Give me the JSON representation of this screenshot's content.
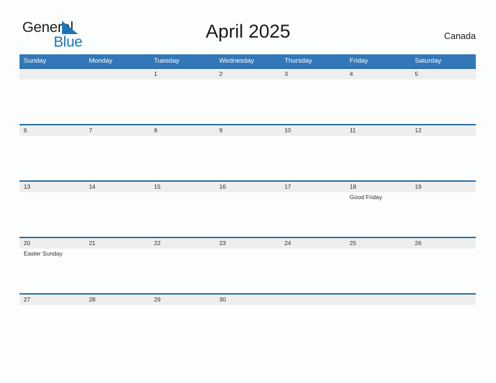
{
  "brand": {
    "name_top": "General",
    "name_bottom": "Blue",
    "accent_color": "#1b75bb",
    "triangle_icon": "triangle-right-icon"
  },
  "header": {
    "title": "April 2025",
    "country": "Canada"
  },
  "theme": {
    "header_blue": "#3277b8",
    "row_rule_blue": "#2b6ca3",
    "row_band_gray": "#eeeeee",
    "page_background": "#fcfdfd",
    "text_color": "#2d2d2d"
  },
  "calendar": {
    "weekdays": [
      "Sunday",
      "Monday",
      "Tuesday",
      "Wednesday",
      "Thursday",
      "Friday",
      "Saturday"
    ],
    "weeks": [
      [
        {
          "date": "",
          "events": []
        },
        {
          "date": "",
          "events": []
        },
        {
          "date": "1",
          "events": []
        },
        {
          "date": "2",
          "events": []
        },
        {
          "date": "3",
          "events": []
        },
        {
          "date": "4",
          "events": []
        },
        {
          "date": "5",
          "events": []
        }
      ],
      [
        {
          "date": "6",
          "events": []
        },
        {
          "date": "7",
          "events": []
        },
        {
          "date": "8",
          "events": []
        },
        {
          "date": "9",
          "events": []
        },
        {
          "date": "10",
          "events": []
        },
        {
          "date": "11",
          "events": []
        },
        {
          "date": "12",
          "events": []
        }
      ],
      [
        {
          "date": "13",
          "events": []
        },
        {
          "date": "14",
          "events": []
        },
        {
          "date": "15",
          "events": []
        },
        {
          "date": "16",
          "events": []
        },
        {
          "date": "17",
          "events": []
        },
        {
          "date": "18",
          "events": [
            "Good Friday"
          ]
        },
        {
          "date": "19",
          "events": []
        }
      ],
      [
        {
          "date": "20",
          "events": [
            "Easter Sunday"
          ]
        },
        {
          "date": "21",
          "events": []
        },
        {
          "date": "22",
          "events": []
        },
        {
          "date": "23",
          "events": []
        },
        {
          "date": "24",
          "events": []
        },
        {
          "date": "25",
          "events": []
        },
        {
          "date": "26",
          "events": []
        }
      ],
      [
        {
          "date": "27",
          "events": []
        },
        {
          "date": "28",
          "events": []
        },
        {
          "date": "29",
          "events": []
        },
        {
          "date": "30",
          "events": []
        },
        {
          "date": "",
          "events": []
        },
        {
          "date": "",
          "events": []
        },
        {
          "date": "",
          "events": []
        }
      ]
    ]
  }
}
